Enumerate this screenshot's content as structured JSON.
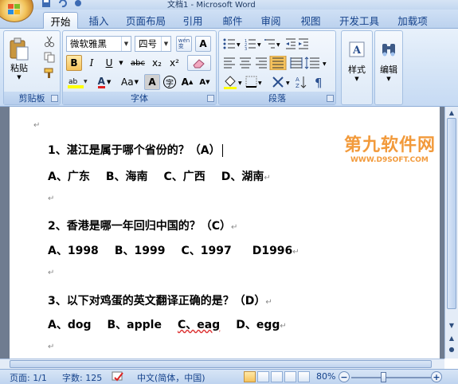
{
  "window": {
    "title": "文档1 - Microsoft Word"
  },
  "tabs": [
    "开始",
    "插入",
    "页面布局",
    "引用",
    "邮件",
    "审阅",
    "视图",
    "开发工具",
    "加载项"
  ],
  "clipboard": {
    "paste": "粘贴",
    "group": "剪贴板"
  },
  "font": {
    "family": "微软雅黑",
    "size": "四号",
    "group": "字体",
    "wen": "wén\n变",
    "A": "A",
    "bold": "B",
    "italic": "I",
    "underline": "U",
    "strike": "abc",
    "sub": "x₂",
    "sup": "x²",
    "aa": "Aa",
    "grow": "A",
    "shrink": "A",
    "charborder": "A",
    "fontcolor": "A",
    "enclose": "字"
  },
  "paragraph": {
    "group": "段落"
  },
  "styles": {
    "label": "样式"
  },
  "editing": {
    "label": "编辑"
  },
  "document": {
    "q1": "1、湛江是属于哪个省份的？（A）",
    "a1": [
      "A、广东",
      "B、海南",
      "C、广西",
      "D、湖南"
    ],
    "q2": "2、香港是哪一年回归中国的？（C）",
    "a2": [
      "A、1998",
      "B、1999",
      "C、1997",
      "D1996"
    ],
    "q3": "3、以下对鸡蛋的英文翻译正确的是？（D）",
    "a3": [
      "A、dog",
      "B、apple",
      "C、eag",
      "D、egg"
    ],
    "paragraph_mark": "↵"
  },
  "watermark": {
    "main": "第九软件网",
    "sub": "WWW.D9SOFT.COM"
  },
  "status": {
    "page": "页面: 1/1",
    "words": "字数: 125",
    "language": "中文(简体，中国)",
    "zoom": "80%"
  }
}
